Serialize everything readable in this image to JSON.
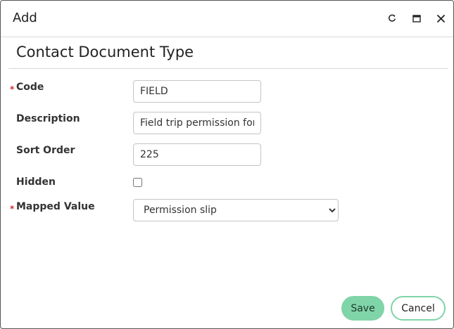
{
  "window": {
    "title": "Add",
    "controls": [
      "refresh-icon",
      "maximize-icon",
      "close-icon"
    ]
  },
  "form": {
    "heading": "Contact Document Type",
    "required_marker": "*",
    "fields": {
      "code": {
        "label": "Code",
        "value": "FIELD",
        "required": true
      },
      "description": {
        "label": "Description",
        "value": "Field trip permission form"
      },
      "sort_order": {
        "label": "Sort Order",
        "value": "225"
      },
      "hidden": {
        "label": "Hidden",
        "checked": false
      },
      "mapped_value": {
        "label": "Mapped Value",
        "selected": "Permission slip",
        "required": true
      }
    }
  },
  "actions": {
    "save_label": "Save",
    "cancel_label": "Cancel"
  },
  "colors": {
    "accent": "#7fd4a8",
    "required": "#d03030"
  }
}
